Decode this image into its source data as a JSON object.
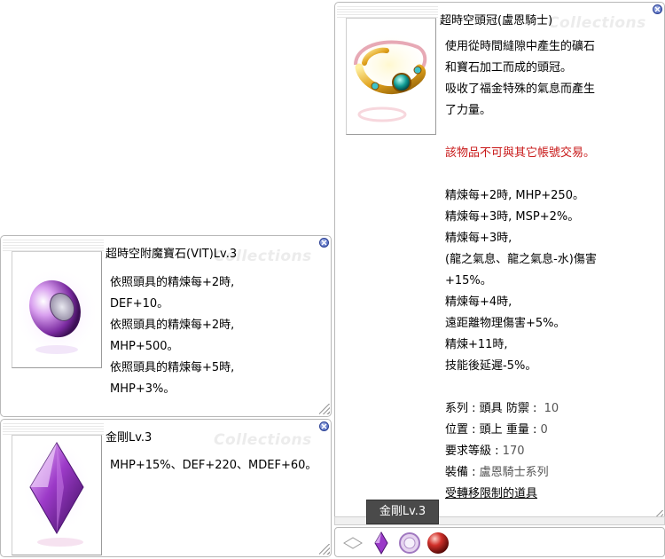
{
  "main_item": {
    "title": "超時空頭冠(盧恩騎士)",
    "watermark": "Collections",
    "icon": "golden-circlet-with-teal-gem",
    "description": [
      "使用從時間縫隙中產生的礦石",
      "和寶石加工而成的頭冠。",
      "吸收了福金特殊的氣息而產生",
      "了力量。"
    ],
    "trade_warning": "該物品不可與其它帳號交易。",
    "refine_effects": [
      "精煉每+2時, MHP+250。",
      "精煉每+3時, MSP+2%。",
      "精煉每+3時,",
      "(龍之氣息、龍之氣息-水)傷害",
      "+15%。",
      "精煉每+4時,",
      "遠距離物理傷害+5%。",
      "精煉+11時,",
      "技能後延遲-5%。"
    ],
    "stats": {
      "series_label": "系列",
      "series_value": "頭具",
      "defense_label": "防禦",
      "defense_value": "10",
      "position_label": "位置",
      "position_value": "頭上",
      "weight_label": "重量",
      "weight_value": "0",
      "level_label": "要求等級",
      "level_value": "170",
      "equip_label": "裝備",
      "equip_value": "盧恩騎士系列"
    },
    "transfer_note": "受轉移限制的道具"
  },
  "enchant_item": {
    "title": "超時空附魔寶石(VIT)Lv.3",
    "watermark": "Collections",
    "icon": "purple-orb-gem",
    "lines": [
      "依照頭具的精煉每+2時,",
      "DEF+10。",
      "依照頭具的精煉每+2時,",
      "MHP+500。",
      "依照頭具的精煉每+5時,",
      "MHP+3%。"
    ]
  },
  "diamond_item": {
    "title": "金剛Lv.3",
    "watermark": "Collections",
    "icon": "purple-diamond-crystal",
    "lines": [
      "MHP+15%、DEF+220、MDEF+60。"
    ]
  },
  "tooltip": "金剛Lv.3",
  "slots": [
    "empty-slot-icon",
    "purple-crystal-slot-icon",
    "white-orb-slot-icon",
    "red-orb-slot-icon"
  ],
  "colors": {
    "warning": "#c81818",
    "close": "#3b56b5"
  }
}
